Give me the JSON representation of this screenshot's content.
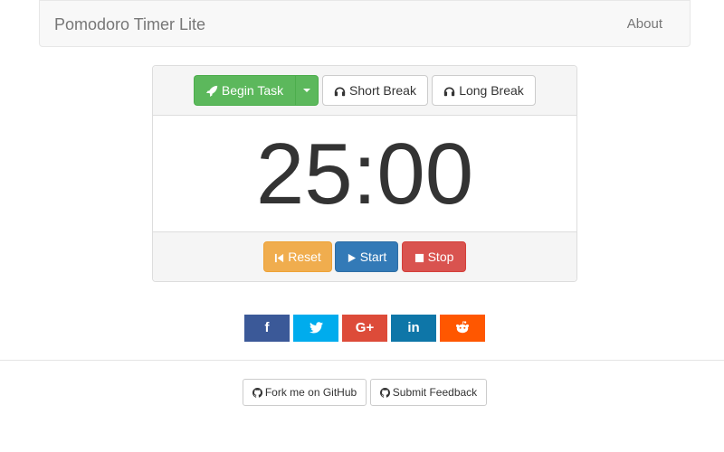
{
  "navbar": {
    "brand": "Pomodoro Timer Lite",
    "about_label": "About"
  },
  "modes": {
    "begin_task_label": "Begin Task",
    "short_break_label": "Short Break",
    "long_break_label": "Long Break"
  },
  "timer": {
    "display": "25:00"
  },
  "controls": {
    "reset_label": "Reset",
    "start_label": "Start",
    "stop_label": "Stop"
  },
  "social": {
    "facebook_glyph": "f",
    "googleplus_glyph": "G+",
    "linkedin_glyph": "in",
    "colors": {
      "facebook": "#3b5998",
      "twitter": "#00aced",
      "googleplus": "#dd4b39",
      "linkedin": "#0e76a8",
      "reddit": "#ff5700"
    }
  },
  "footer": {
    "github_label": "Fork me on GitHub",
    "feedback_label": "Submit Feedback"
  }
}
